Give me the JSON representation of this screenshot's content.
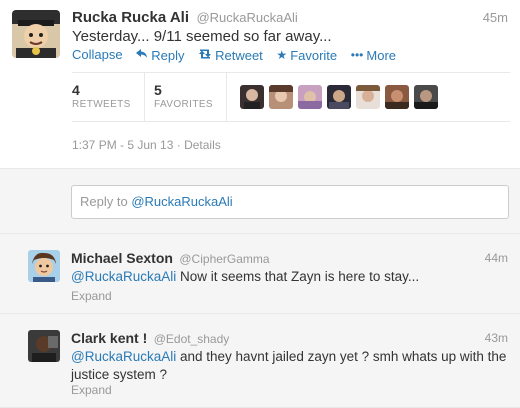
{
  "tweet": {
    "fullname": "Rucka Rucka Ali",
    "handle": "@RuckaRuckaAli",
    "time": "45m",
    "text": "Yesterday... 9/11 seemed so far away...",
    "actions": {
      "collapse": "Collapse",
      "reply": "Reply",
      "retweet": "Retweet",
      "favorite": "Favorite",
      "more": "More"
    },
    "stats": {
      "retweets_count": "4",
      "retweets_label": "RETWEETS",
      "favorites_count": "5",
      "favorites_label": "FAVORITES"
    },
    "favoriter_avatars": 7,
    "date": "1:37 PM - 5 Jun 13",
    "separator": "·",
    "details_link": "Details"
  },
  "reply_box": {
    "prefix": "Reply to ",
    "mention": "@RuckaRuckaAli"
  },
  "replies": [
    {
      "fullname": "Michael Sexton",
      "handle": "@CipherGamma",
      "time": "44m",
      "mention": "@RuckaRuckaAli",
      "text": " Now it seems that Zayn is here to stay...",
      "expand": "Expand"
    },
    {
      "fullname": "Clark kent !",
      "handle": "@Edot_shady",
      "time": "43m",
      "mention": "@RuckaRuckaAli",
      "text": " and they havnt jailed zayn yet ? smh whats up with the justice system ?",
      "expand": "Expand"
    }
  ],
  "colors": {
    "link": "#2a7ab7",
    "muted": "#999999",
    "text": "#333333",
    "reply_bg": "#f5f5f5"
  }
}
